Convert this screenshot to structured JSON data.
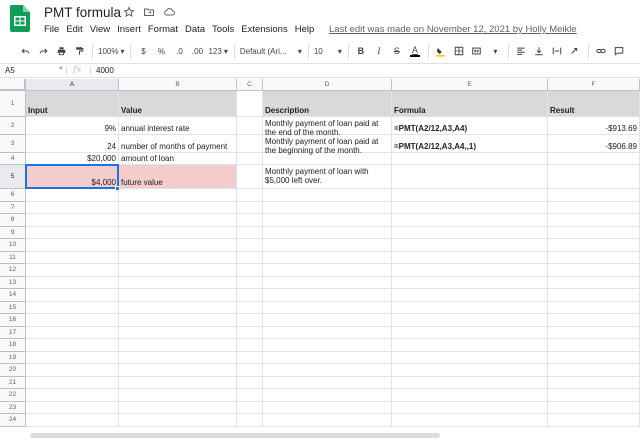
{
  "app": {
    "title": "PMT formula",
    "last_edit": "Last edit was made on November 12, 2021 by Holly Meikle"
  },
  "menu": [
    "File",
    "Edit",
    "View",
    "Insert",
    "Format",
    "Data",
    "Tools",
    "Extensions",
    "Help"
  ],
  "toolbar": {
    "zoom": "100%",
    "currency": "$",
    "percent": "%",
    "dec_decrease": ".0",
    "dec_increase": ".00",
    "more_formats": "123",
    "font": "Default (Ari...",
    "font_size": "10",
    "bold": "B",
    "italic": "I",
    "strike": "S",
    "text_color": "A"
  },
  "formula_bar": {
    "cell_ref": "A5",
    "fx": "fx",
    "value": "4000"
  },
  "columns": [
    "A",
    "B",
    "C",
    "D",
    "E",
    "F"
  ],
  "rows": [
    "1",
    "2",
    "3",
    "4",
    "5",
    "6",
    "7",
    "8",
    "9",
    "10",
    "11",
    "12",
    "13",
    "14",
    "15",
    "16",
    "17",
    "18",
    "19",
    "20",
    "21",
    "22",
    "23",
    "24"
  ],
  "cells": {
    "A1": "Input",
    "B1": "Value",
    "D1": "Description",
    "E1": "Formula",
    "F1": "Result",
    "A2": "9%",
    "B2": "annual interest rate",
    "D2": "Monthly payment of loan paid at the end of the month.",
    "E2": "=PMT(A2/12,A3,A4)",
    "F2": "-$913.69",
    "A3": "24",
    "B3": "number of months of payment",
    "D3": "Monthly payment of loan paid at the beginning of the month.",
    "E3": "=PMT(A2/12,A3,A4,,1)",
    "F3": "-$906.89",
    "A4": "$20,000",
    "B4": "amount of loan",
    "A5": "$4,000",
    "B5": "future value",
    "D5": "Monthly payment of loan with $5,000 left over."
  },
  "colors": {
    "header_fill": "#d9d9d9",
    "highlight_fill": "#f4cccc",
    "selection": "#1a73e8",
    "brand_green": "#0f9d58"
  }
}
